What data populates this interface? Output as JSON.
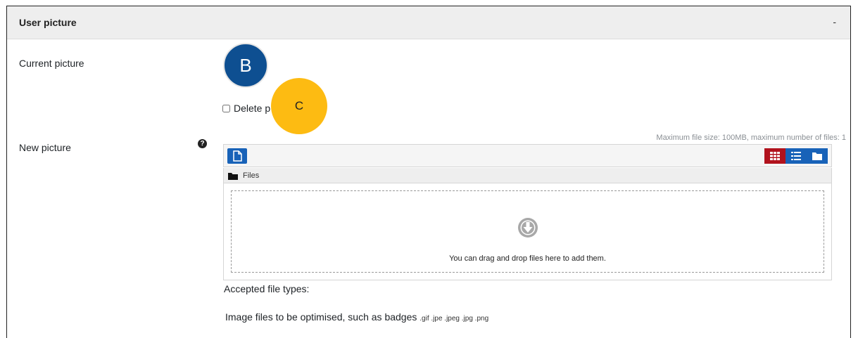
{
  "section": {
    "title": "User picture",
    "toggle": "-"
  },
  "current_picture": {
    "label": "Current picture",
    "avatar_letter": "B",
    "avatar_color": "#0e4f91",
    "delete_label": "Delete p"
  },
  "marker": {
    "label": "C",
    "color": "#fdbb12"
  },
  "new_picture": {
    "label": "New picture",
    "help_icon": "question-circle"
  },
  "filemanager": {
    "limits": "Maximum file size: 100MB, maximum number of files: 1",
    "path_label": "Files",
    "drop_text": "You can drag and drop files here to add them.",
    "view_modes": [
      "grid-icon",
      "list-icon",
      "folder-icon"
    ],
    "active_view": "grid-icon",
    "accent": "#1862b8",
    "active_color": "#b1121d"
  },
  "accepted": {
    "label": "Accepted file types:",
    "description": "Image files to be optimised, such as badges",
    "extensions": ".gif .jpe .jpeg .jpg .png"
  }
}
